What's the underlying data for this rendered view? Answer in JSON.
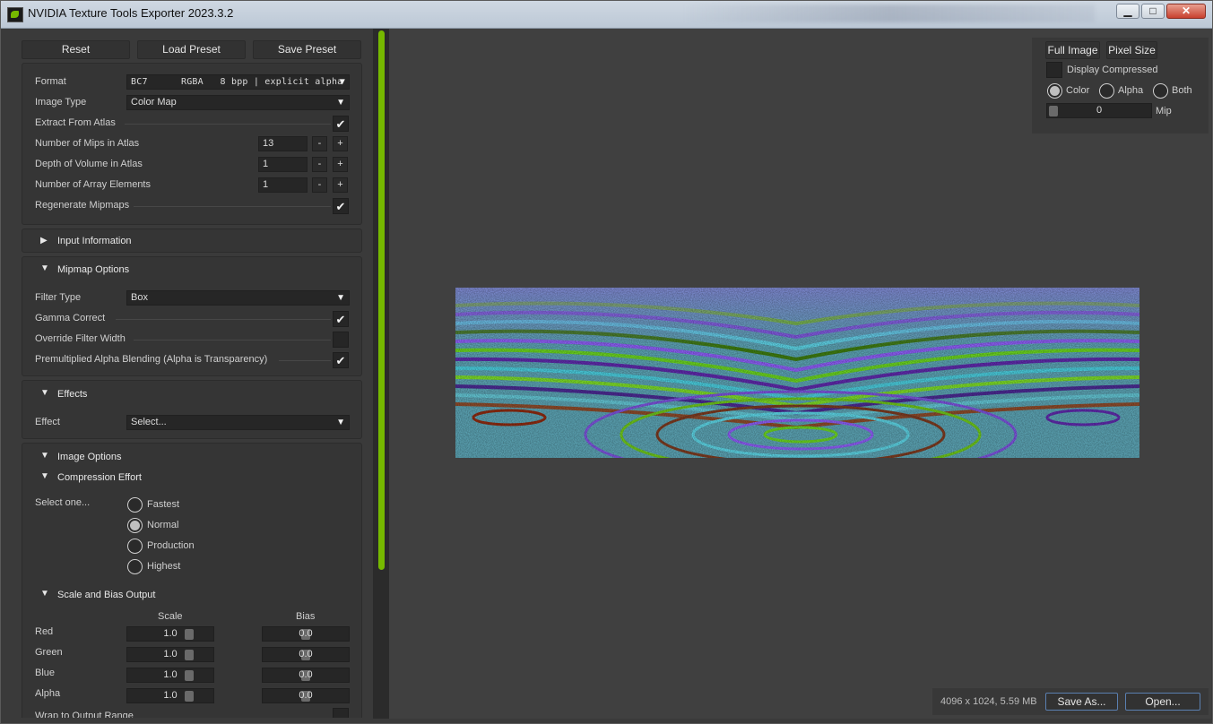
{
  "window": {
    "title": "NVIDIA Texture Tools Exporter 2023.3.2",
    "controls": [
      "minimize",
      "maximize",
      "close"
    ]
  },
  "top_buttons": {
    "reset": "Reset",
    "load_preset": "Load Preset",
    "save_preset": "Save Preset"
  },
  "main_settings": {
    "format": {
      "label": "Format",
      "value": "BC7      RGBA   8 bpp | explicit alpha"
    },
    "image_type": {
      "label": "Image Type",
      "value": "Color Map"
    },
    "extract_from_atlas": {
      "label": "Extract From Atlas",
      "checked": true
    },
    "mips_in_atlas": {
      "label": "Number of Mips in Atlas",
      "value": "13"
    },
    "depth_of_volume": {
      "label": "Depth of Volume in Atlas",
      "value": "1"
    },
    "array_elements": {
      "label": "Number of Array Elements",
      "value": "1"
    },
    "regenerate_mipmaps": {
      "label": "Regenerate Mipmaps",
      "checked": true
    },
    "minus": "-",
    "plus": "+"
  },
  "input_information": {
    "header": "Input Information",
    "expanded": false
  },
  "mipmap_options": {
    "header": "Mipmap Options",
    "filter_type": {
      "label": "Filter Type",
      "value": "Box"
    },
    "gamma_correct": {
      "label": "Gamma Correct",
      "checked": true
    },
    "override_filter_width": {
      "label": "Override Filter Width",
      "checked": false
    },
    "premultiplied_alpha": {
      "label": "Premultiplied Alpha Blending (Alpha is Transparency)",
      "checked": true
    }
  },
  "effects": {
    "header": "Effects",
    "effect": {
      "label": "Effect",
      "value": "Select..."
    }
  },
  "image_options": {
    "header": "Image Options",
    "compression_effort": {
      "header": "Compression Effort",
      "prompt": "Select one...",
      "options": [
        "Fastest",
        "Normal",
        "Production",
        "Highest"
      ],
      "selected": "Normal"
    },
    "scale_bias": {
      "header": "Scale and Bias Output",
      "scale_header": "Scale",
      "bias_header": "Bias",
      "rows": [
        {
          "label": "Red",
          "scale": "1.0",
          "bias": "0.0"
        },
        {
          "label": "Green",
          "scale": "1.0",
          "bias": "0.0"
        },
        {
          "label": "Blue",
          "scale": "1.0",
          "bias": "0.0"
        },
        {
          "label": "Alpha",
          "scale": "1.0",
          "bias": "0.0"
        }
      ]
    },
    "wrap_label": "Wrap to Output Range"
  },
  "viewer": {
    "full_image": "Full Image",
    "pixel_size": "Pixel Size",
    "display_compressed": "Display Compressed",
    "channels": [
      "Color",
      "Alpha",
      "Both"
    ],
    "selected_channel": "Color",
    "mip_value": "0",
    "mip_label": "Mip"
  },
  "status": {
    "info": "4096 x 1024, 5.59 MB",
    "save_as": "Save As...",
    "open": "Open..."
  },
  "colors": {
    "accent": "#76b900",
    "panel": "#353535",
    "viewer_bg": "#404040"
  }
}
